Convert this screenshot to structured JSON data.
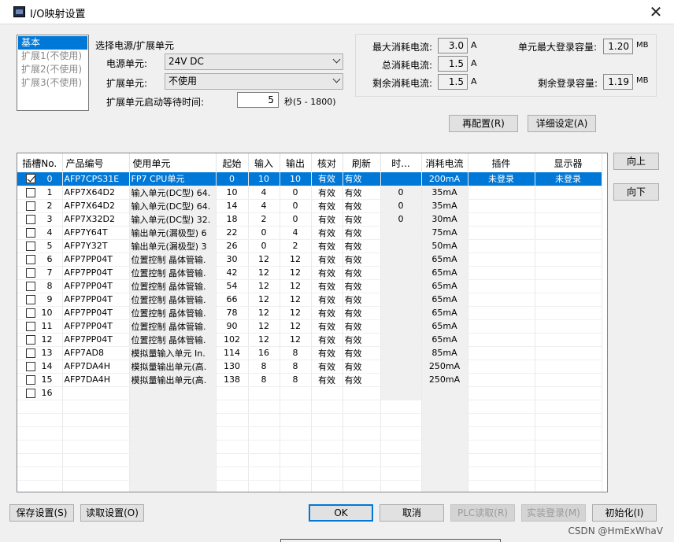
{
  "window": {
    "title": "I/O映射设置",
    "close_glyph": "✕"
  },
  "nav": {
    "items": [
      "基本",
      "扩展1(不使用)",
      "扩展2(不使用)",
      "扩展3(不使用)"
    ]
  },
  "power_group": {
    "title": "选择电源/扩展单元",
    "power_label": "电源单元:",
    "power_value": "24V DC",
    "ext_label": "扩展单元:",
    "ext_value": "不使用",
    "wait_label": "扩展单元启动等待时间:",
    "wait_value": "5",
    "wait_range": "秒(5 - 1800)"
  },
  "info": {
    "max_current_label": "最大消耗电流:",
    "max_current_value": "3.0",
    "total_current_label": "总消耗电流:",
    "total_current_value": "1.5",
    "remain_current_label": "剩余消耗电流:",
    "remain_current_value": "1.5",
    "current_unit": "A",
    "max_capacity_label": "单元最大登录容量:",
    "max_capacity_value": "1.20",
    "remain_capacity_label": "剩余登录容量:",
    "remain_capacity_value": "1.19",
    "capacity_unit": "MB"
  },
  "buttons": {
    "reconfig": "再配置(R)",
    "detail": "详细设定(A)",
    "up": "向上",
    "down": "向下",
    "save": "保存设置(S)",
    "load": "读取设置(O)",
    "ok": "OK",
    "cancel": "取消",
    "plc_read": "PLC读取(R)",
    "real_login": "实装登录(M)",
    "init": "初始化(I)"
  },
  "table": {
    "columns": [
      "插槽No.",
      "产品编号",
      "使用单元",
      "起始",
      "输入",
      "输出",
      "核对",
      "刷新",
      "时...",
      "消耗电流",
      "插件",
      "显示器"
    ],
    "rows": [
      {
        "checked": true,
        "slot": "0",
        "product": "AFP7CPS31E",
        "unit": "FP7 CPU单元",
        "start": "0",
        "in": "10",
        "out": "10",
        "check": "有效",
        "refresh": "有效",
        "time": "",
        "current": "200mA",
        "plugin": "未登录",
        "display": "未登录"
      },
      {
        "checked": false,
        "slot": "1",
        "product": "AFP7X64D2",
        "unit": "输入单元(DC型) 64.",
        "start": "10",
        "in": "4",
        "out": "0",
        "check": "有效",
        "refresh": "有效",
        "time": "0",
        "current": "35mA",
        "plugin": "",
        "display": ""
      },
      {
        "checked": false,
        "slot": "2",
        "product": "AFP7X64D2",
        "unit": "输入单元(DC型) 64.",
        "start": "14",
        "in": "4",
        "out": "0",
        "check": "有效",
        "refresh": "有效",
        "time": "0",
        "current": "35mA",
        "plugin": "",
        "display": ""
      },
      {
        "checked": false,
        "slot": "3",
        "product": "AFP7X32D2",
        "unit": "输入单元(DC型) 32.",
        "start": "18",
        "in": "2",
        "out": "0",
        "check": "有效",
        "refresh": "有效",
        "time": "0",
        "current": "30mA",
        "plugin": "",
        "display": ""
      },
      {
        "checked": false,
        "slot": "4",
        "product": "AFP7Y64T",
        "unit": "输出单元(漏极型) 6",
        "start": "22",
        "in": "0",
        "out": "4",
        "check": "有效",
        "refresh": "有效",
        "time": "",
        "current": "75mA",
        "plugin": "",
        "display": ""
      },
      {
        "checked": false,
        "slot": "5",
        "product": "AFP7Y32T",
        "unit": "输出单元(漏极型) 3",
        "start": "26",
        "in": "0",
        "out": "2",
        "check": "有效",
        "refresh": "有效",
        "time": "",
        "current": "50mA",
        "plugin": "",
        "display": ""
      },
      {
        "checked": false,
        "slot": "6",
        "product": "AFP7PP04T",
        "unit": "位置控制 晶体管输.",
        "start": "30",
        "in": "12",
        "out": "12",
        "check": "有效",
        "refresh": "有效",
        "time": "",
        "current": "65mA",
        "plugin": "",
        "display": ""
      },
      {
        "checked": false,
        "slot": "7",
        "product": "AFP7PP04T",
        "unit": "位置控制 晶体管输.",
        "start": "42",
        "in": "12",
        "out": "12",
        "check": "有效",
        "refresh": "有效",
        "time": "",
        "current": "65mA",
        "plugin": "",
        "display": ""
      },
      {
        "checked": false,
        "slot": "8",
        "product": "AFP7PP04T",
        "unit": "位置控制 晶体管输.",
        "start": "54",
        "in": "12",
        "out": "12",
        "check": "有效",
        "refresh": "有效",
        "time": "",
        "current": "65mA",
        "plugin": "",
        "display": ""
      },
      {
        "checked": false,
        "slot": "9",
        "product": "AFP7PP04T",
        "unit": "位置控制 晶体管输.",
        "start": "66",
        "in": "12",
        "out": "12",
        "check": "有效",
        "refresh": "有效",
        "time": "",
        "current": "65mA",
        "plugin": "",
        "display": ""
      },
      {
        "checked": false,
        "slot": "10",
        "product": "AFP7PP04T",
        "unit": "位置控制 晶体管输.",
        "start": "78",
        "in": "12",
        "out": "12",
        "check": "有效",
        "refresh": "有效",
        "time": "",
        "current": "65mA",
        "plugin": "",
        "display": ""
      },
      {
        "checked": false,
        "slot": "11",
        "product": "AFP7PP04T",
        "unit": "位置控制 晶体管输.",
        "start": "90",
        "in": "12",
        "out": "12",
        "check": "有效",
        "refresh": "有效",
        "time": "",
        "current": "65mA",
        "plugin": "",
        "display": ""
      },
      {
        "checked": false,
        "slot": "12",
        "product": "AFP7PP04T",
        "unit": "位置控制 晶体管输.",
        "start": "102",
        "in": "12",
        "out": "12",
        "check": "有效",
        "refresh": "有效",
        "time": "",
        "current": "65mA",
        "plugin": "",
        "display": ""
      },
      {
        "checked": false,
        "slot": "13",
        "product": "AFP7AD8",
        "unit": "模拟量输入单元 In.",
        "start": "114",
        "in": "16",
        "out": "8",
        "check": "有效",
        "refresh": "有效",
        "time": "",
        "current": "85mA",
        "plugin": "",
        "display": ""
      },
      {
        "checked": false,
        "slot": "14",
        "product": "AFP7DA4H",
        "unit": "模拟量输出单元(高.",
        "start": "130",
        "in": "8",
        "out": "8",
        "check": "有效",
        "refresh": "有效",
        "time": "",
        "current": "250mA",
        "plugin": "",
        "display": ""
      },
      {
        "checked": false,
        "slot": "15",
        "product": "AFP7DA4H",
        "unit": "模拟量输出单元(高.",
        "start": "138",
        "in": "8",
        "out": "8",
        "check": "有效",
        "refresh": "有效",
        "time": "",
        "current": "250mA",
        "plugin": "",
        "display": ""
      },
      {
        "checked": false,
        "slot": "16",
        "product": "",
        "unit": "",
        "start": "",
        "in": "",
        "out": "",
        "check": "",
        "refresh": "",
        "time": "",
        "current": "",
        "plugin": "",
        "display": ""
      }
    ],
    "empty_rows": 7
  },
  "watermark": "CSDN @HmExWhaV"
}
